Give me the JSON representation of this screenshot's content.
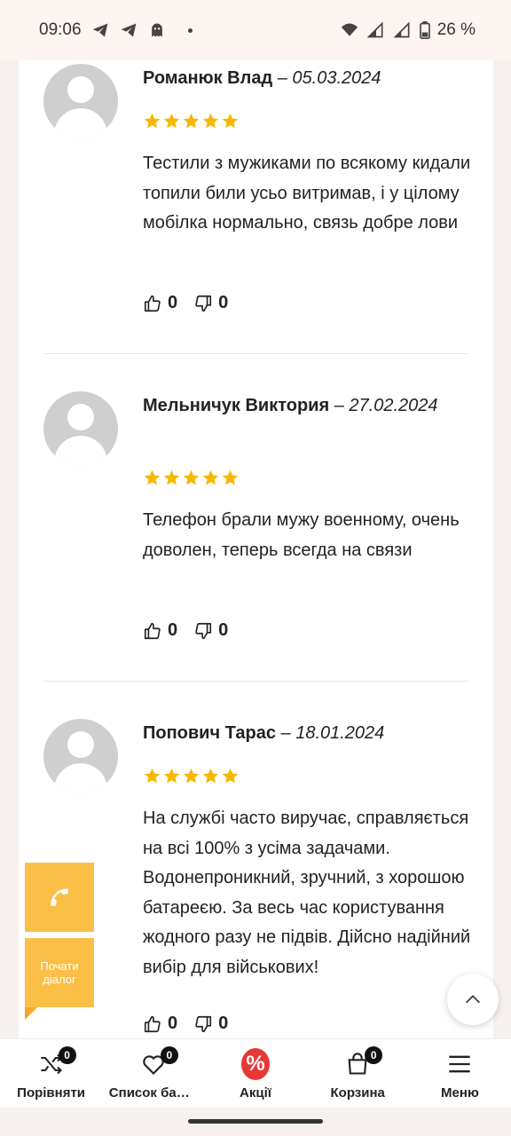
{
  "status_bar": {
    "time": "09:06",
    "battery": "26 %",
    "left_icons": [
      "telegram-icon",
      "telegram-icon",
      "ghost-icon"
    ],
    "right_icons": [
      "wifi-icon",
      "signal-icon",
      "signal-icon",
      "battery-icon"
    ]
  },
  "reviews": [
    {
      "author": "Романюк Влад",
      "date": "05.03.2024",
      "rating": 5,
      "text": "Тестили з мужиками по всякому кидали топили били усьо витримав, і у цілому мобілка нормально, связь добре лови",
      "likes": "0",
      "dislikes": "0"
    },
    {
      "author": "Мельничук Виктория",
      "date": "27.02.2024",
      "rating": 5,
      "text": "Телефон брали мужу военному, очень доволен, теперь всегда на связи",
      "likes": "0",
      "dislikes": "0"
    },
    {
      "author": "Попович Тарас",
      "date": "18.01.2024",
      "rating": 5,
      "text": "На службі часто виручає, справляється на всі 100% з усіма задачами. Водонепроникний, зручний, з хорошою батареєю. За весь час користування жодного разу не підвів. Дійсно надійний вибір для військових!",
      "likes": "0",
      "dislikes": "0"
    }
  ],
  "review_separator": "–",
  "floating": {
    "chat_label": "Почати діалог"
  },
  "bottom_nav": [
    {
      "label": "Порівняти",
      "icon": "compare-icon",
      "badge": "0"
    },
    {
      "label": "Список бажань",
      "icon": "heart-icon",
      "badge": "0"
    },
    {
      "label": "Акції",
      "icon": "percent-icon",
      "promo_symbol": "%"
    },
    {
      "label": "Корзина",
      "icon": "cart-icon",
      "badge": "0"
    },
    {
      "label": "Меню",
      "icon": "menu-icon"
    }
  ],
  "colors": {
    "accent": "#fbbf47",
    "star": "#f5b800",
    "promo": "#e53935"
  }
}
